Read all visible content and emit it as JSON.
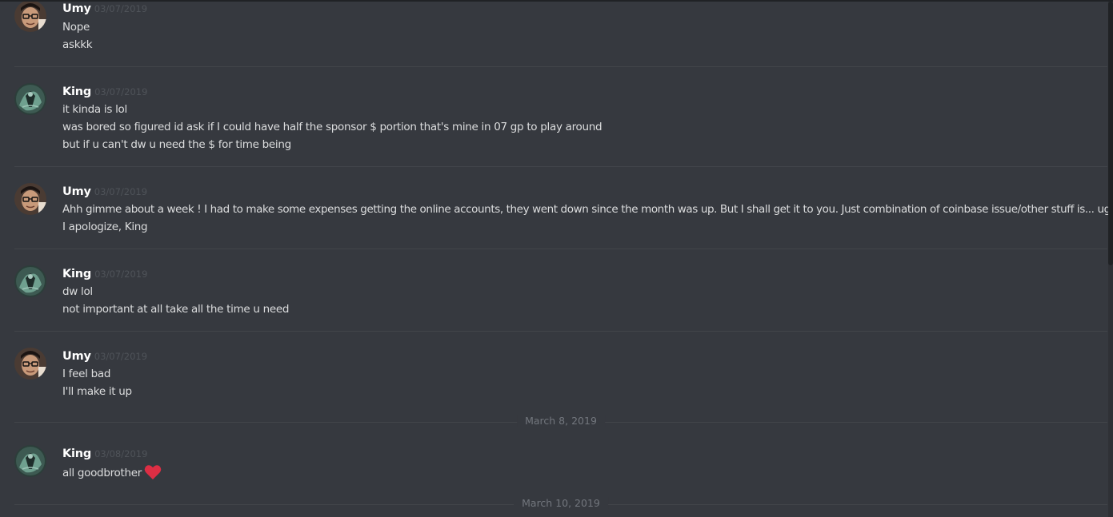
{
  "messages": [
    {
      "user": "Umy",
      "avatar": "umy-avatar",
      "time": "03/07/2019",
      "lines": [
        "Nope",
        "askkk"
      ]
    },
    {
      "user": "King",
      "avatar": "king-avatar",
      "time": "03/07/2019",
      "lines": [
        "it kinda is lol",
        "was bored so figured id ask if I could have half the sponsor $ portion that's mine in 07 gp to play around",
        "but if u can't dw u need the $ for time being"
      ]
    },
    {
      "user": "Umy",
      "avatar": "umy-avatar",
      "time": "03/07/2019",
      "lines": [
        "Ahh gimme about a week ! I had to make some expenses getting the online accounts, they went down since the month was up. But I shall get it to you. Just combination of coinbase issue/other stuff is... ugh :x",
        "I apologize, King"
      ]
    },
    {
      "user": "King",
      "avatar": "king-avatar",
      "time": "03/07/2019",
      "lines": [
        "dw lol",
        "not important at all take all the time u need"
      ]
    },
    {
      "user": "Umy",
      "avatar": "umy-avatar",
      "time": "03/07/2019",
      "lines": [
        "I feel bad",
        "I'll make it up"
      ]
    },
    {
      "user": "King",
      "avatar": "king-avatar",
      "time": "03/08/2019",
      "lines": [
        "all goodbrother"
      ],
      "emoji": "heart-emoji"
    }
  ],
  "dividers": [
    "March 8, 2019",
    "March 10, 2019"
  ],
  "colors": {
    "background": "#36393f",
    "username": "#ffffff",
    "timestamp": "#4f5359",
    "text": "#dcddde",
    "divider_text": "#72767d",
    "heart": "#dd2e44"
  }
}
